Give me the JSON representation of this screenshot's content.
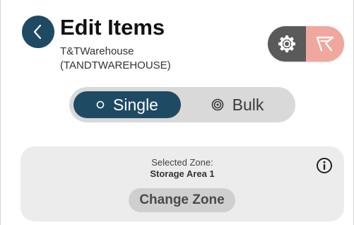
{
  "header": {
    "title": "Edit Items",
    "warehouse_name": "T&TWarehouse",
    "warehouse_code": "(TANDTWAREHOUSE)"
  },
  "icons": {
    "back": "chevron-left-icon",
    "settings": "gear-icon",
    "brand": "brand-logo-icon",
    "single": "circle-icon",
    "bulk": "target-icon",
    "info": "info-icon"
  },
  "mode_toggle": {
    "single_label": "Single",
    "bulk_label": "Bulk",
    "selected": "Single"
  },
  "zone": {
    "label": "Selected Zone:",
    "value": "Storage Area 1",
    "change_button_label": "Change Zone"
  },
  "colors": {
    "primary": "#1e4a64",
    "settings_bg": "#5a5a5a",
    "brand_bg": "#f0a79e",
    "toggle_bg": "#d9d9d9",
    "card_bg": "#ececec",
    "button_bg": "#cfcfcf"
  }
}
